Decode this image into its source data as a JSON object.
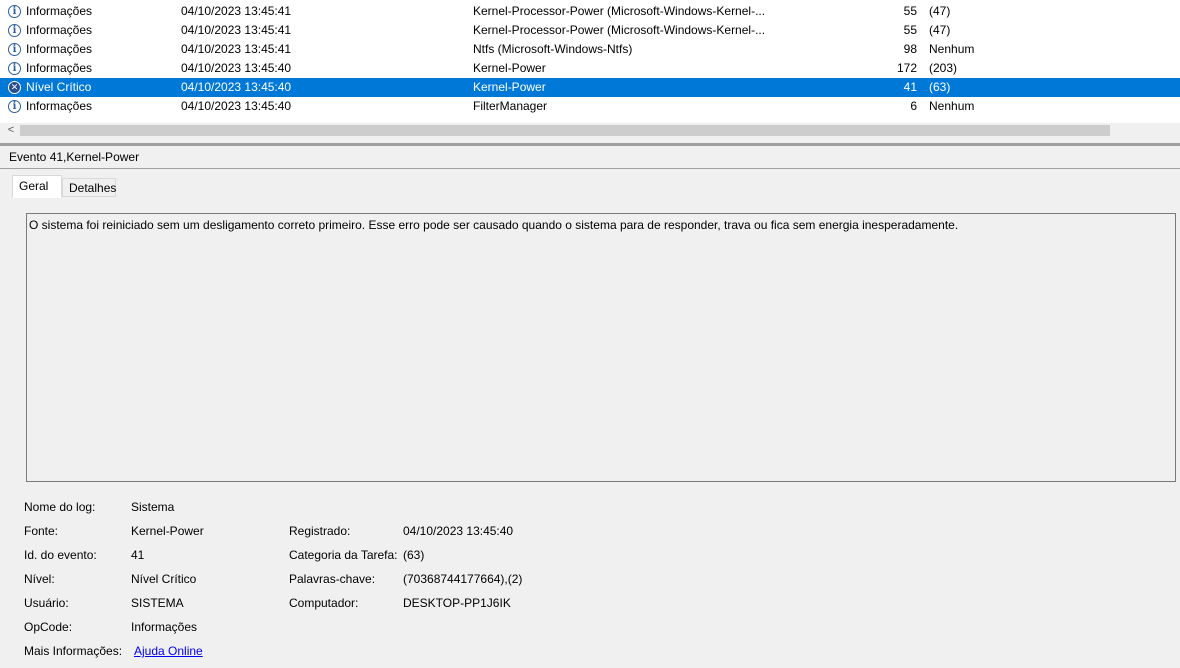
{
  "events": [
    {
      "level": "Informações",
      "level_icon": "info-icon",
      "date": "04/10/2023 13:45:41",
      "source": "Kernel-Processor-Power (Microsoft-Windows-Kernel-...",
      "event_id": "55",
      "category": "(47)",
      "selected": false
    },
    {
      "level": "Informações",
      "level_icon": "info-icon",
      "date": "04/10/2023 13:45:41",
      "source": "Kernel-Processor-Power (Microsoft-Windows-Kernel-...",
      "event_id": "55",
      "category": "(47)",
      "selected": false
    },
    {
      "level": "Informações",
      "level_icon": "info-icon",
      "date": "04/10/2023 13:45:41",
      "source": "Ntfs (Microsoft-Windows-Ntfs)",
      "event_id": "98",
      "category": "Nenhum",
      "selected": false
    },
    {
      "level": "Informações",
      "level_icon": "info-icon",
      "date": "04/10/2023 13:45:40",
      "source": "Kernel-Power",
      "event_id": "172",
      "category": "(203)",
      "selected": false
    },
    {
      "level": "Nível Crítico",
      "level_icon": "critical-icon",
      "date": "04/10/2023 13:45:40",
      "source": "Kernel-Power",
      "event_id": "41",
      "category": "(63)",
      "selected": true
    },
    {
      "level": "Informações",
      "level_icon": "info-icon",
      "date": "04/10/2023 13:45:40",
      "source": "FilterManager",
      "event_id": "6",
      "category": "Nenhum",
      "selected": false
    }
  ],
  "scrollbar": {
    "left_arrow": "<"
  },
  "detail": {
    "title": "Evento 41,Kernel-Power",
    "tabs": [
      "Geral",
      "Detalhes"
    ],
    "description": "O sistema foi reiniciado sem um desligamento correto primeiro. Esse erro pode ser causado quando o sistema para de responder, trava ou fica sem energia inesperadamente.",
    "props": {
      "log_name": {
        "label": "Nome do log:",
        "value": "Sistema"
      },
      "source": {
        "label": "Fonte:",
        "value": "Kernel-Power"
      },
      "logged": {
        "label": "Registrado:",
        "value": "04/10/2023 13:45:40"
      },
      "event_id": {
        "label": "Id. do evento:",
        "value": "41"
      },
      "task_category": {
        "label": "Categoria da Tarefa:",
        "value": "(63)"
      },
      "level": {
        "label": "Nível:",
        "value": "Nível Crítico"
      },
      "keywords": {
        "label": "Palavras-chave:",
        "value": "(70368744177664),(2)"
      },
      "user": {
        "label": "Usuário:",
        "value": "SISTEMA"
      },
      "computer": {
        "label": "Computador:",
        "value": "DESKTOP-PP1J6IK"
      },
      "opcode": {
        "label": "OpCode:",
        "value": "Informações"
      },
      "more_info": {
        "label": "Mais Informações:",
        "value": "Ajuda Online"
      }
    }
  },
  "colors": {
    "selection": "#0078d7",
    "link": "#0000ee"
  }
}
